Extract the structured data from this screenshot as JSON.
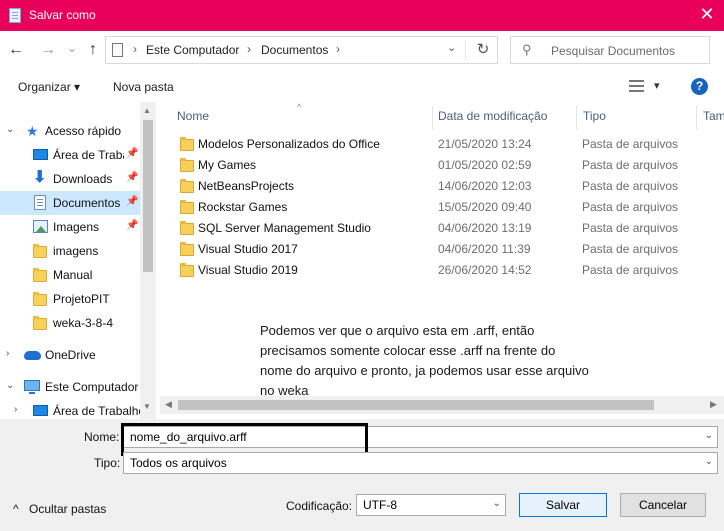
{
  "window": {
    "title": "Salvar como",
    "close_glyph": "✕",
    "accent": "#e8005a"
  },
  "nav": {
    "back_glyph": "←",
    "forward_glyph": "→",
    "recent_glyph": "⌄",
    "up_glyph": "↑",
    "breadcrumb": [
      "Este Computador",
      "Documentos"
    ],
    "sep_glyph": "›",
    "refresh_glyph": "↻",
    "search_placeholder": "Pesquisar Documentos",
    "search_glyph": "⚲"
  },
  "toolbar": {
    "organize_label": "Organizar ▾",
    "new_folder_label": "Nova pasta",
    "view_dropdown_glyph": "▾",
    "help_glyph": "?"
  },
  "sidebar": {
    "items": [
      {
        "label": "Acesso rápido",
        "icon": "star-icon",
        "caret": "⌄",
        "pinned": false
      },
      {
        "label": "Área de Trabalho",
        "icon": "desktop-icon",
        "pinned": true
      },
      {
        "label": "Downloads",
        "icon": "download-icon",
        "pinned": true
      },
      {
        "label": "Documentos",
        "icon": "documents-icon",
        "pinned": true,
        "selected": true
      },
      {
        "label": "Imagens",
        "icon": "pictures-icon",
        "pinned": true
      },
      {
        "label": "imagens",
        "icon": "folder-icon",
        "pinned": false
      },
      {
        "label": "Manual",
        "icon": "folder-icon",
        "pinned": false
      },
      {
        "label": "ProjetoPIT",
        "icon": "folder-icon",
        "pinned": false
      },
      {
        "label": "weka-3-8-4",
        "icon": "folder-icon",
        "pinned": false
      },
      {
        "label": "OneDrive",
        "icon": "onedrive-icon",
        "caret": "›",
        "pinned": false
      },
      {
        "label": "Este Computador",
        "icon": "computer-icon",
        "caret": "⌄",
        "pinned": false
      },
      {
        "label": "Área de Trabalho",
        "icon": "desktop-icon",
        "caret": "›",
        "pinned": false
      }
    ],
    "pin_glyph": "📌",
    "download_glyph": "⬇",
    "star_glyph": "★"
  },
  "filelist": {
    "columns": [
      "Nome",
      "Data de modificação",
      "Tipo",
      "Tam"
    ],
    "sort_glyph": "^",
    "rows": [
      {
        "name": "Modelos Personalizados do Office",
        "date": "21/05/2020 13:24",
        "type": "Pasta de arquivos"
      },
      {
        "name": "My Games",
        "date": "01/05/2020 02:59",
        "type": "Pasta de arquivos"
      },
      {
        "name": "NetBeansProjects",
        "date": "14/06/2020 12:03",
        "type": "Pasta de arquivos"
      },
      {
        "name": "Rockstar Games",
        "date": "15/05/2020 09:40",
        "type": "Pasta de arquivos"
      },
      {
        "name": "SQL Server Management Studio",
        "date": "04/06/2020 13:19",
        "type": "Pasta de arquivos"
      },
      {
        "name": "Visual Studio 2017",
        "date": "04/06/2020 11:39",
        "type": "Pasta de arquivos"
      },
      {
        "name": "Visual Studio 2019",
        "date": "26/06/2020 14:52",
        "type": "Pasta de arquivos"
      }
    ]
  },
  "annotation": {
    "text": "Podemos ver que o arquivo esta em .arff, então precisamos somente colocar esse .arff na frente do nome do arquivo e pronto, ja podemos usar esse arquivo no weka"
  },
  "form": {
    "name_label": "Nome:",
    "name_value": "nome_do_arquivo.arff",
    "type_label": "Tipo:",
    "type_value": "Todos os arquivos",
    "encoding_label": "Codificação:",
    "encoding_value": "UTF-8",
    "save_label": "Salvar",
    "cancel_label": "Cancelar",
    "hide_folders_label": "Ocultar pastas",
    "hide_folders_glyph": "^",
    "dropdown_glyph": "⌄"
  }
}
